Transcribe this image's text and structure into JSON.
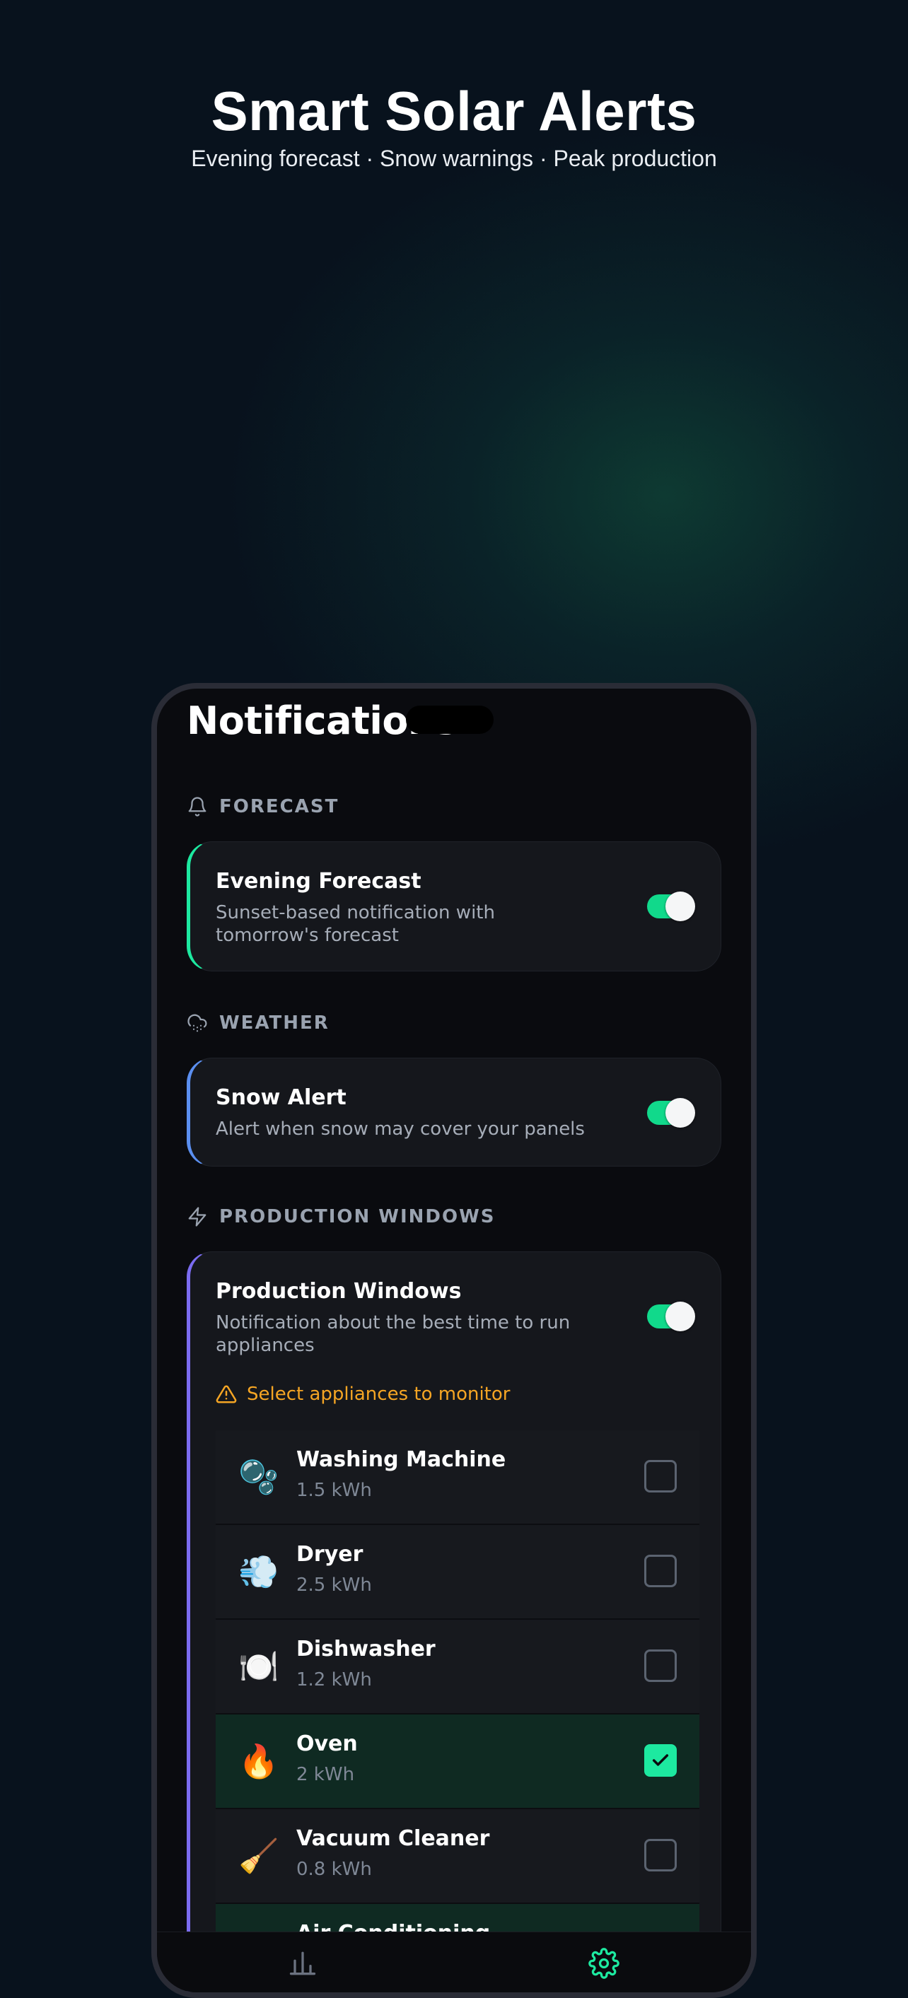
{
  "hero": {
    "title": "Smart Solar Alerts",
    "subtitle": "Evening forecast · Snow warnings · Peak production"
  },
  "screen": {
    "title": "Notifications"
  },
  "sections": {
    "forecast": {
      "heading": "FORECAST",
      "icon": "bell-icon",
      "card": {
        "title": "Evening Forecast",
        "description": "Sunset-based notification with tomorrow's forecast",
        "enabled": true,
        "accent": "#1de9a0"
      }
    },
    "weather": {
      "heading": "WEATHER",
      "icon": "snow-cloud-icon",
      "card": {
        "title": "Snow Alert",
        "description": "Alert when snow may cover your panels",
        "enabled": true,
        "accent": "#5b8ff0"
      }
    },
    "production": {
      "heading": "PRODUCTION WINDOWS",
      "icon": "lightning-icon",
      "card": {
        "title": "Production Windows",
        "description": "Notification about the best time to run appliances",
        "enabled": true,
        "accent": "#7b6cf0",
        "warning": "Select appliances to monitor"
      },
      "appliances": [
        {
          "name": "Washing Machine",
          "kwh": "1.5 kWh",
          "icon": "🫧",
          "checked": false
        },
        {
          "name": "Dryer",
          "kwh": "2.5 kWh",
          "icon": "💨",
          "checked": false
        },
        {
          "name": "Dishwasher",
          "kwh": "1.2 kWh",
          "icon": "🍽️",
          "checked": false
        },
        {
          "name": "Oven",
          "kwh": "2 kWh",
          "icon": "🔥",
          "checked": true
        },
        {
          "name": "Vacuum Cleaner",
          "kwh": "0.8 kWh",
          "icon": "🧹",
          "checked": false
        },
        {
          "name": "Air Conditioning",
          "kwh": "",
          "icon": "❄️",
          "checked": true
        }
      ]
    }
  },
  "tabbar": {
    "items": [
      "stats-tab-icon",
      "settings-tab-icon"
    ],
    "active_color": "#1de9a0"
  }
}
